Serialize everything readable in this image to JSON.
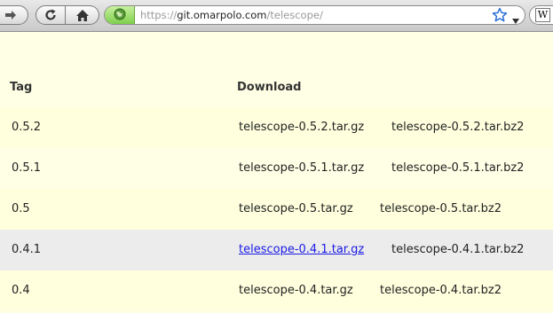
{
  "browser": {
    "url_prefix": "https://",
    "url_host": "git.omarpolo.com",
    "url_path": "/telescope/",
    "search_engine_glyph": "W"
  },
  "table": {
    "headers": {
      "tag": "Tag",
      "download": "Download"
    },
    "rows": [
      {
        "tag": "0.5.2",
        "gz": "telescope-0.5.2.tar.gz",
        "bz2": "telescope-0.5.2.tar.bz2"
      },
      {
        "tag": "0.5.1",
        "gz": "telescope-0.5.1.tar.gz",
        "bz2": "telescope-0.5.1.tar.bz2"
      },
      {
        "tag": "0.5",
        "gz": "telescope-0.5.tar.gz",
        "bz2": "telescope-0.5.tar.bz2"
      },
      {
        "tag": "0.4.1",
        "gz": "telescope-0.4.1.tar.gz",
        "bz2": "telescope-0.4.1.tar.bz2"
      },
      {
        "tag": "0.4",
        "gz": "telescope-0.4.tar.gz",
        "bz2": "telescope-0.4.tar.bz2"
      }
    ]
  },
  "colors": {
    "page_bg": "#ffffe6",
    "hover_row_bg": "#ececec",
    "link": "#1a1ae6",
    "secure_identity": "#7fcf4c"
  }
}
